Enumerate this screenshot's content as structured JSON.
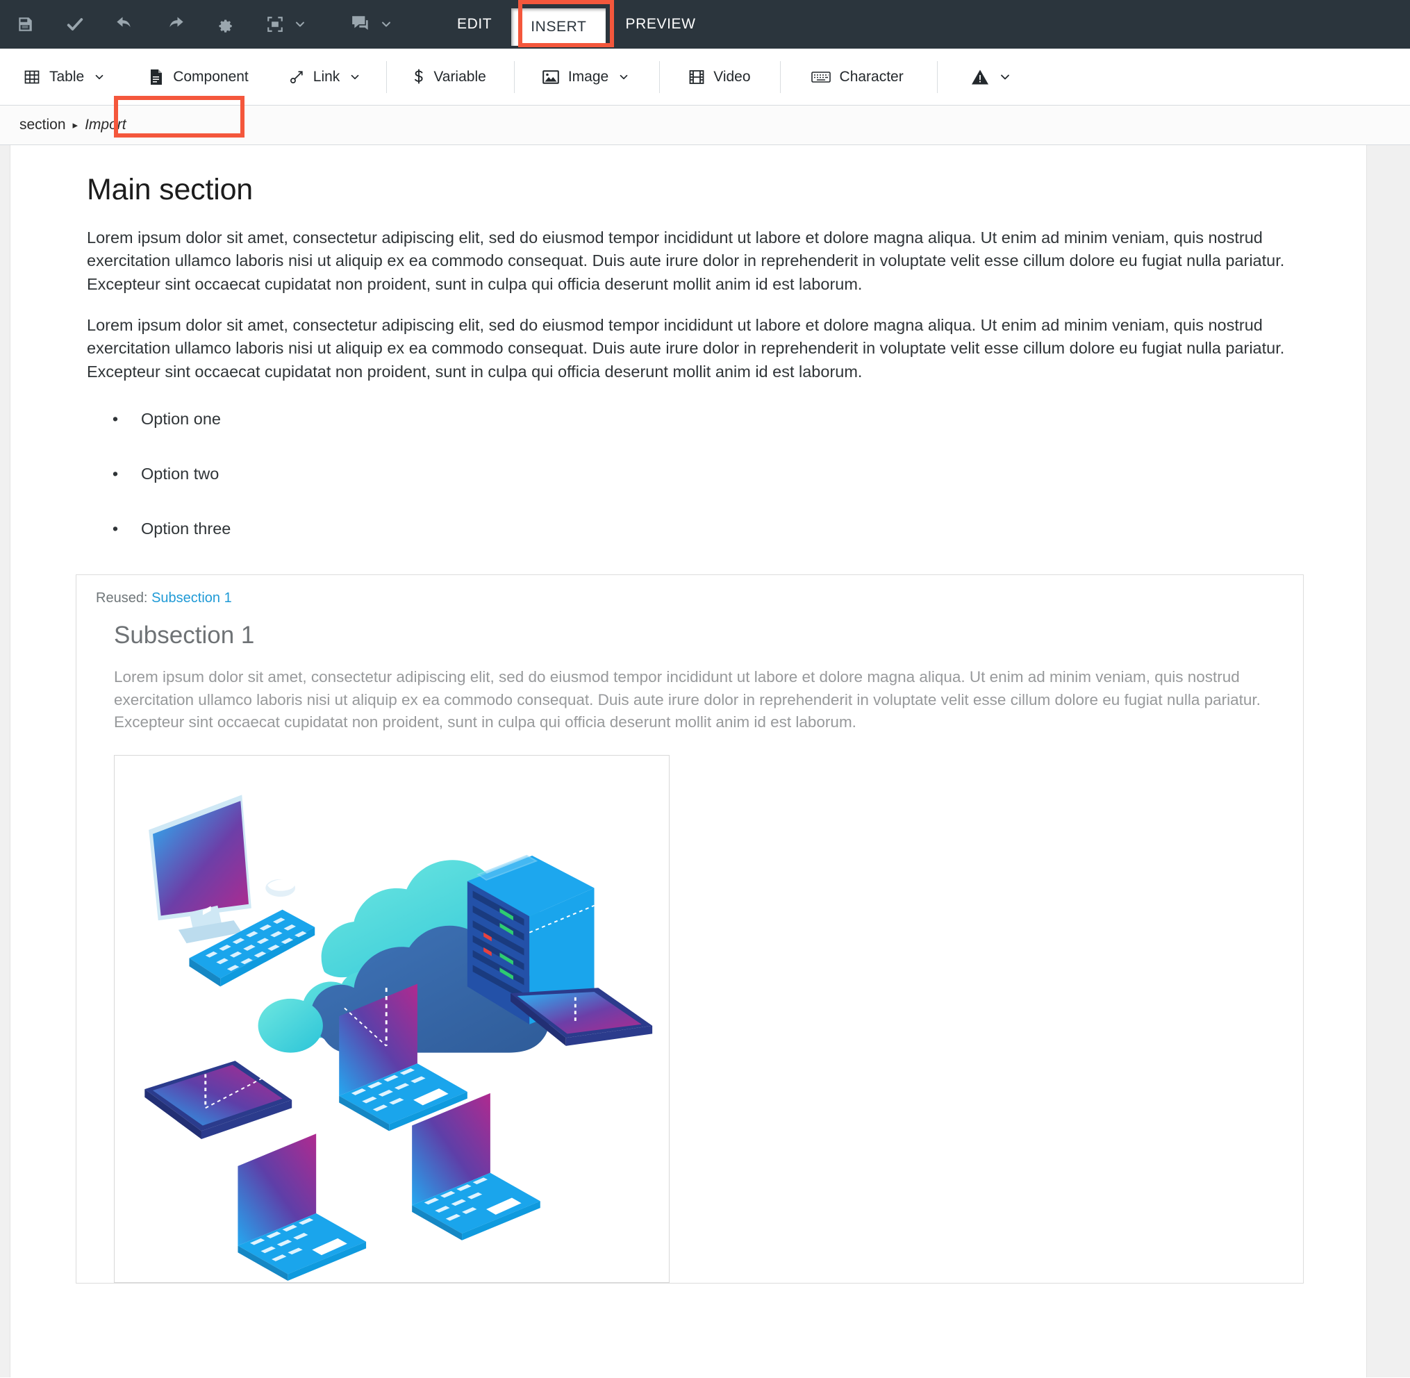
{
  "topbar": {
    "icons": [
      {
        "name": "save-icon",
        "label": "Save"
      },
      {
        "name": "check-icon",
        "label": "Approve"
      },
      {
        "name": "undo-icon",
        "label": "Undo"
      },
      {
        "name": "redo-icon",
        "label": "Redo"
      },
      {
        "name": "gear-icon",
        "label": "Settings"
      },
      {
        "name": "fullscreen-icon",
        "label": "Fullscreen"
      },
      {
        "name": "comment-icon",
        "label": "Comments"
      }
    ],
    "tabs": [
      {
        "label": "EDIT",
        "active": false
      },
      {
        "label": "INSERT",
        "active": true
      },
      {
        "label": "PREVIEW",
        "active": false
      }
    ],
    "background_color": "#2b353d",
    "highlight_color": "#f4573c"
  },
  "insert_toolbar": {
    "items": [
      {
        "label": "Table",
        "icon": "table-icon",
        "has_dropdown": true
      },
      {
        "label": "Component",
        "icon": "document-icon",
        "has_dropdown": false,
        "highlighted": true
      },
      {
        "label": "Link",
        "icon": "link-icon",
        "has_dropdown": true
      },
      {
        "label": "Variable",
        "icon": "dollar-icon",
        "has_dropdown": false
      },
      {
        "label": "Image",
        "icon": "image-icon",
        "has_dropdown": true
      },
      {
        "label": "Video",
        "icon": "video-icon",
        "has_dropdown": false
      },
      {
        "label": "Character",
        "icon": "keyboard-icon",
        "has_dropdown": false
      },
      {
        "label": "",
        "icon": "warning-icon",
        "has_dropdown": true
      }
    ]
  },
  "breadcrumb": {
    "root": "section",
    "separator": "▸",
    "current": "Import"
  },
  "document": {
    "title": "Main section",
    "paragraphs": [
      "Lorem ipsum dolor sit amet, consectetur adipiscing elit, sed do eiusmod tempor incididunt ut labore et dolore magna aliqua. Ut enim ad minim veniam, quis nostrud exercitation ullamco laboris nisi ut aliquip ex ea commodo consequat. Duis aute irure dolor in reprehenderit in voluptate velit esse cillum dolore eu fugiat nulla pariatur. Excepteur sint occaecat cupidatat non proident, sunt in culpa qui officia deserunt mollit anim id est laborum.",
      "Lorem ipsum dolor sit amet, consectetur adipiscing elit, sed do eiusmod tempor incididunt ut labore et dolore magna aliqua. Ut enim ad minim veniam, quis nostrud exercitation ullamco laboris nisi ut aliquip ex ea commodo consequat. Duis aute irure dolor in reprehenderit in voluptate velit esse cillum dolore eu fugiat nulla pariatur. Excepteur sint occaecat cupidatat non proident, sunt in culpa qui officia deserunt mollit anim id est laborum."
    ],
    "bullet_glyph": "•",
    "list_items": [
      "Option one",
      "Option two",
      "Option three"
    ],
    "reused_component": {
      "prefix": "Reused:",
      "link_label": "Subsection 1",
      "title": "Subsection 1",
      "body": "Lorem ipsum dolor sit amet, consectetur adipiscing elit, sed do eiusmod tempor incididunt ut labore et dolore magna aliqua. Ut enim ad minim veniam, quis nostrud exercitation ullamco laboris nisi ut aliquip ex ea commodo consequat. Duis aute irure dolor in reprehenderit in voluptate velit esse cillum dolore eu fugiat nulla pariatur. Excepteur sint occaecat cupidatat non proident, sunt in culpa qui officia deserunt mollit anim id est laborum.",
      "image_alt": "isometric cloud computing illustration",
      "link_color": "#1f9ad6"
    }
  }
}
